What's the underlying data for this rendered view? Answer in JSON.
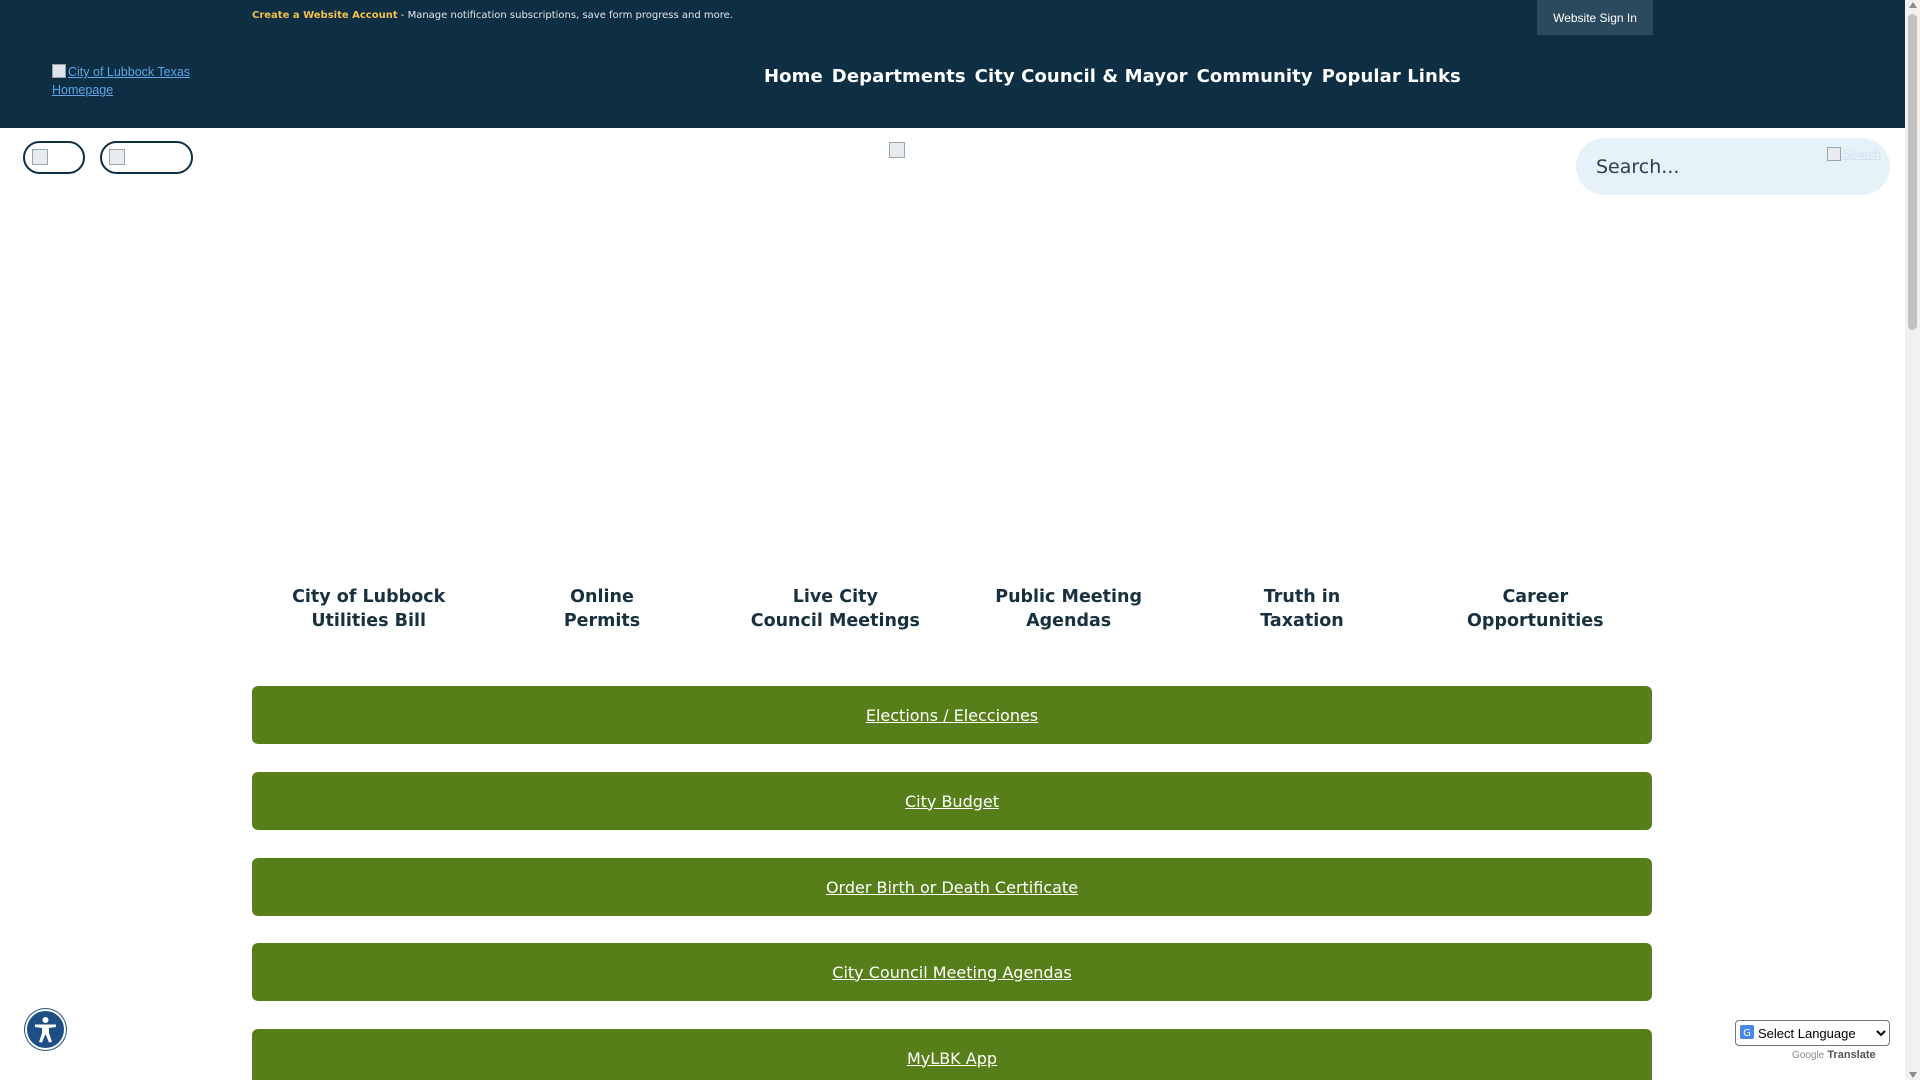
{
  "header": {
    "create_account_link": "Create a Website Account",
    "create_account_desc": " - Manage notification subscriptions, save form progress and more.",
    "sign_in": "Website Sign In",
    "logo_alt": "City of Lubbock Texas Homepage",
    "nav": [
      "Home",
      "Departments",
      "City Council & Mayor",
      "Community",
      "Popular Links"
    ]
  },
  "search": {
    "placeholder": "Search...",
    "button_alt": "Search"
  },
  "quick_links": [
    "City of Lubbock\nUtilities Bill",
    "Online\nPermits",
    "Live City\nCouncil Meetings",
    "Public Meeting\nAgendas",
    "Truth in\nTaxation",
    "Career\nOpportunities"
  ],
  "buttons": [
    "Elections / Elecciones",
    "City Budget",
    "Order Birth or Death Certificate",
    "City Council Meeting Agendas",
    "MyLBK App"
  ],
  "translate": {
    "select_label": "Select Language",
    "powered_by": "Google",
    "translate_link": "Translate"
  },
  "icons": {
    "accessibility": "accessibility-icon",
    "google": "google-g-icon"
  },
  "colors": {
    "header_bg": "#0e2e43",
    "button_green": "#567f1a",
    "account_link": "#f2c14b",
    "search_bg": "#e5f2fa"
  }
}
